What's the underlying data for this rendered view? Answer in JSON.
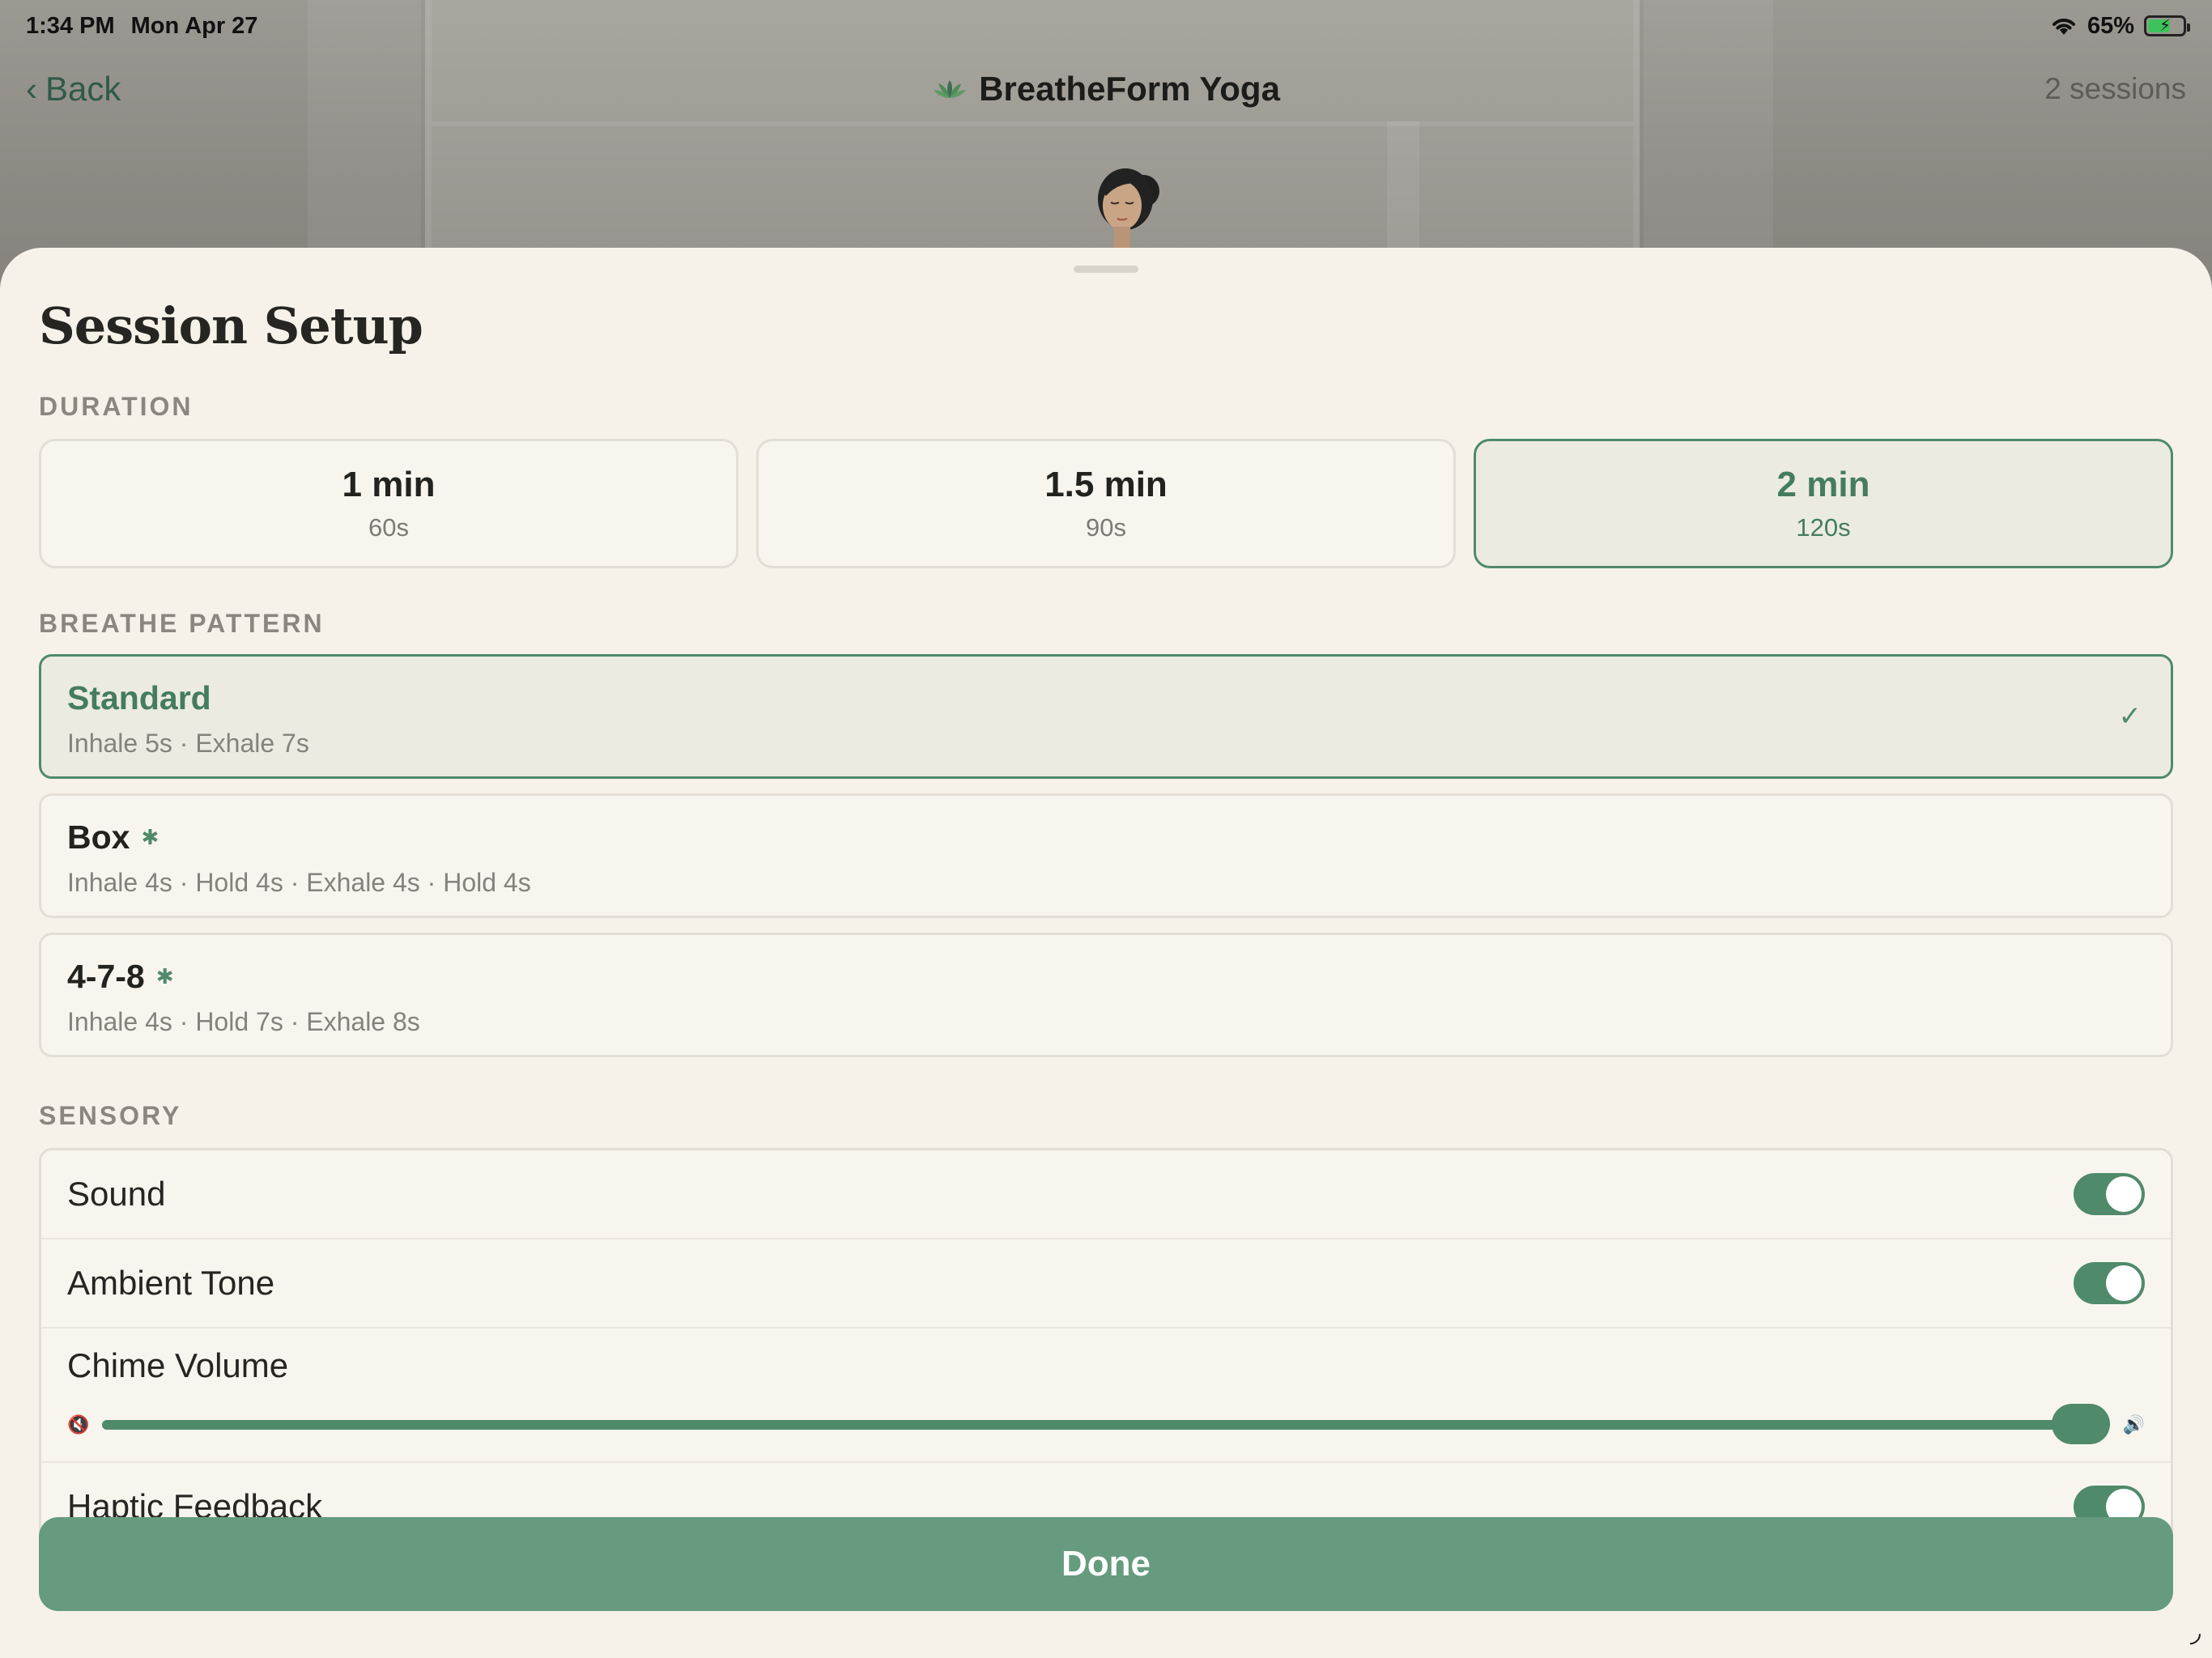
{
  "status_bar": {
    "time": "1:34 PM",
    "date": "Mon Apr 27",
    "battery": "65%",
    "battery_level": 0.65,
    "wifi_icon": "wifi-icon",
    "battery_icon": "battery-charging-icon"
  },
  "nav": {
    "back_label": "Back",
    "title": "BreatheForm Yoga",
    "sessions": "2 sessions",
    "logo_icon": "lotus-icon"
  },
  "sheet": {
    "title": "Session Setup",
    "duration": {
      "label": "DURATION",
      "options": [
        {
          "label": "1 min",
          "sub": "60s",
          "selected": false
        },
        {
          "label": "1.5 min",
          "sub": "90s",
          "selected": false
        },
        {
          "label": "2 min",
          "sub": "120s",
          "selected": true
        }
      ]
    },
    "pattern": {
      "label": "BREATHE PATTERN",
      "options": [
        {
          "name": "Standard",
          "desc": "Inhale 5s · Exhale 7s",
          "selected": true
        },
        {
          "name": "Box",
          "desc": "Inhale 4s · Hold 4s · Exhale 4s · Hold 4s",
          "selected": false
        },
        {
          "name": "4-7-8",
          "desc": "Inhale 4s · Hold 7s · Exhale 8s",
          "selected": false
        }
      ]
    },
    "sensory": {
      "label": "SENSORY",
      "sound_label": "Sound",
      "sound_on": true,
      "ambient_label": "Ambient Tone",
      "ambient_on": true,
      "chime_label": "Chime Volume",
      "chime_volume": 1.0,
      "haptic_label": "Haptic Feedback",
      "haptic_on": true
    },
    "done_label": "Done"
  },
  "colors": {
    "accent": "#4f8a6a",
    "done_button": "#669b7f",
    "sheet_bg": "#f6f2ea"
  }
}
